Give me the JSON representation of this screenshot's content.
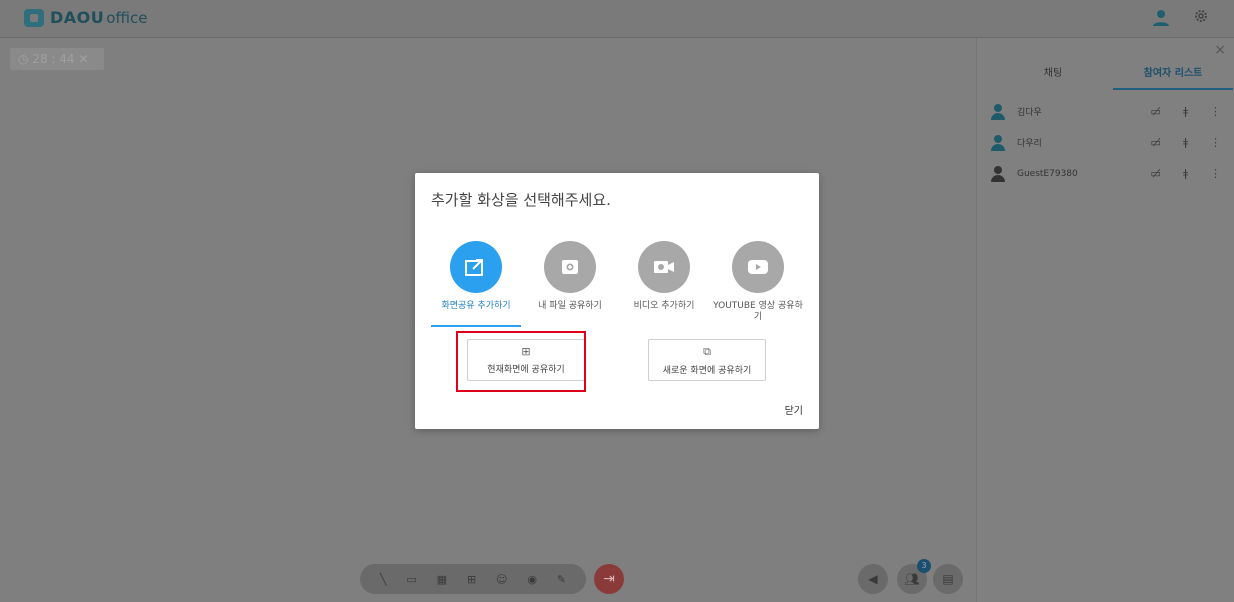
{
  "header": {
    "logo_brand": "DAOU",
    "logo_product": "office",
    "icons": [
      "user-icon",
      "gear-icon"
    ]
  },
  "video": {
    "timer": "28 : 44",
    "timer_close": "✕"
  },
  "sidebar": {
    "close": "×",
    "tabs": [
      {
        "label": "채팅",
        "active": false
      },
      {
        "label": "참여자 리스트",
        "active": true
      }
    ],
    "participants": [
      {
        "name": "김다우"
      },
      {
        "name": "다우리"
      },
      {
        "name": "GuestE79380"
      }
    ]
  },
  "modal": {
    "title": "추가할 화상을 선택해주세요.",
    "options": [
      {
        "label": "화면공유 추가하기",
        "icon": "share-screen-icon",
        "active": true
      },
      {
        "label": "내 파일 공유하기",
        "icon": "file-icon",
        "active": false
      },
      {
        "label": "비디오 추가하기",
        "icon": "video-icon",
        "active": false
      },
      {
        "label": "YOUTUBE 영상 공유하기",
        "icon": "youtube-icon",
        "active": false
      }
    ],
    "share_current": "현재화면에 공유하기",
    "share_new": "새로운 화면에 공유하기",
    "close_label": "닫기"
  },
  "bottom": {
    "participants_badge": "3"
  },
  "colors": {
    "accent": "#2aa0ee",
    "highlight": "#e0001a"
  }
}
